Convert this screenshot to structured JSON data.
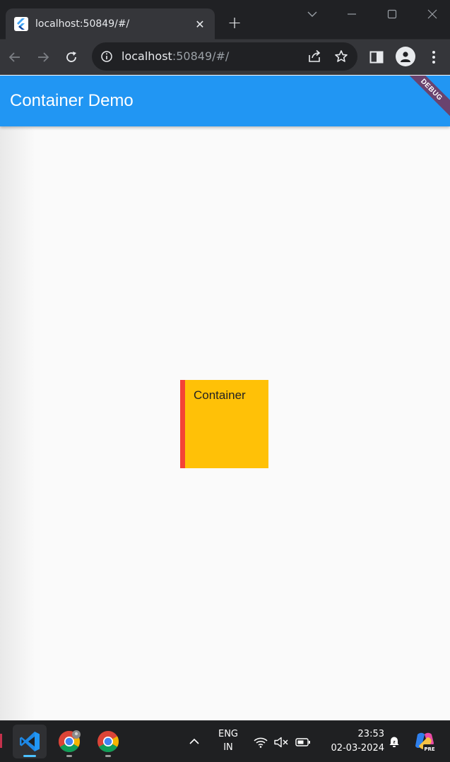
{
  "browser": {
    "tab": {
      "title": "localhost:50849/#/",
      "close_label": "✕"
    },
    "new_tab_label": "+",
    "address": {
      "host": "localhost",
      "rest": ":50849/#/"
    }
  },
  "app": {
    "title": "Container Demo",
    "debug_banner": "DEBUG",
    "container": {
      "label": "Container",
      "fill_color": "#ffc107",
      "border_color": "#f44336"
    },
    "appbar_color": "#2196f3"
  },
  "taskbar": {
    "language": {
      "line1": "ENG",
      "line2": "IN"
    },
    "clock": {
      "time": "23:53",
      "date": "02-03-2024"
    },
    "apps": [
      "vscode-icon",
      "chrome-icon",
      "chrome-icon"
    ]
  }
}
